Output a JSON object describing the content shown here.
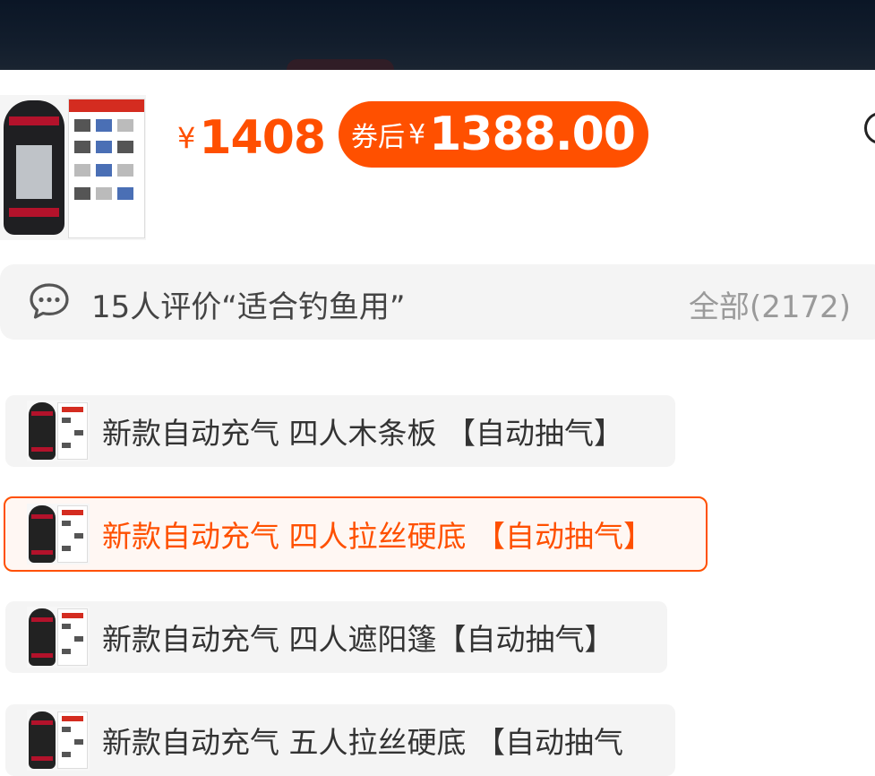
{
  "price": {
    "currency": "¥",
    "original": "1408",
    "coupon_label": "券后",
    "coupon_price": "1388.00"
  },
  "review": {
    "icon": "chat-bubble-icon",
    "summary": "15人评价“适合钓鱼用”",
    "all_label": "全部(2172)"
  },
  "sku_options": [
    {
      "label": "新款自动充气 四人木条板 【自动抽气】",
      "selected": false
    },
    {
      "label": "新款自动充气 四人拉丝硬底 【自动抽气】",
      "selected": true
    },
    {
      "label": "新款自动充气 四人遮阳篷【自动抽气】",
      "selected": false
    },
    {
      "label": "新款自动充气 五人拉丝硬底 【自动抽气",
      "selected": false
    }
  ],
  "colors": {
    "accent": "#ff5000",
    "selected_bg": "#fff7f3",
    "option_bg": "#f4f4f4"
  }
}
